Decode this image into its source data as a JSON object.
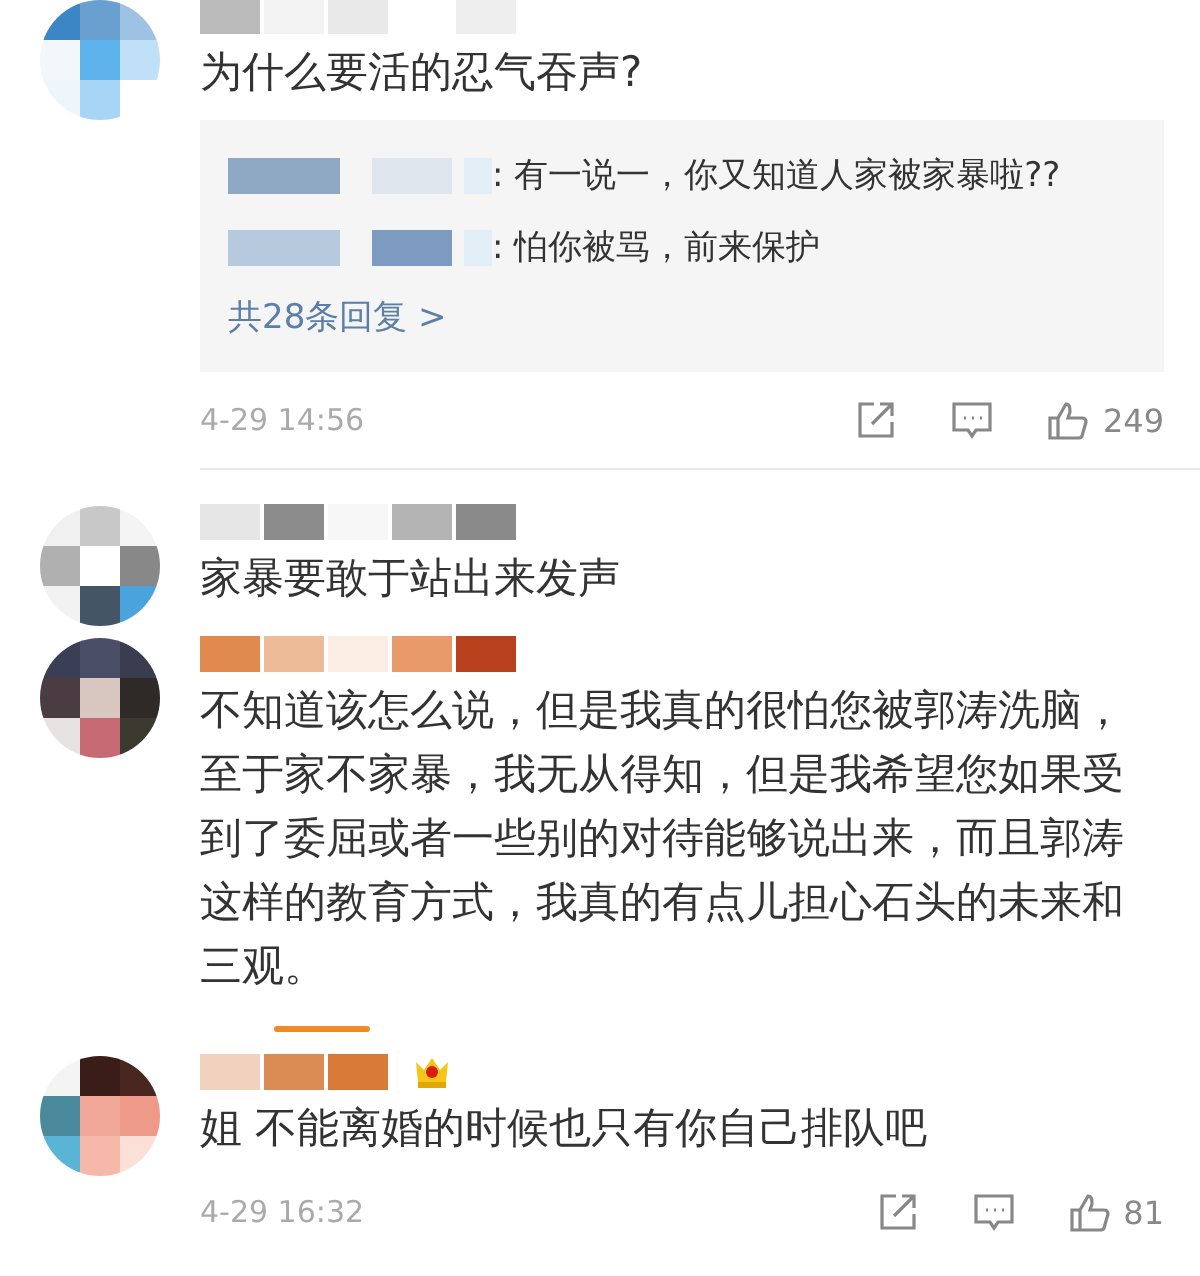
{
  "comments": [
    {
      "crowned": false,
      "text": "为什么要活的忍气吞声?",
      "replies": {
        "items": [
          {
            "text": ": 有一说一，你又知道人家被家暴啦??"
          },
          {
            "text": ": 怕你被骂，前来保护"
          }
        ],
        "more": "共28条回复 >"
      },
      "footer": {
        "time": "4-29 14:56",
        "likes": "249"
      }
    },
    {
      "crowned": false,
      "text": "家暴要敢于站出来发声"
    },
    {
      "crowned": false,
      "text": "不知道该怎么说，但是我真的很怕您被郭涛洗脑，至于家不家暴，我无从得知，但是我希望您如果受到了委屈或者一些别的对待能够说出来，而且郭涛这样的教育方式，我真的有点儿担心石头的未来和三观。"
    },
    {
      "crowned": true,
      "text": "姐 不能离婚的时候也只有你自己排队吧",
      "footer": {
        "time": "4-29 16:32",
        "likes": "81"
      }
    }
  ]
}
